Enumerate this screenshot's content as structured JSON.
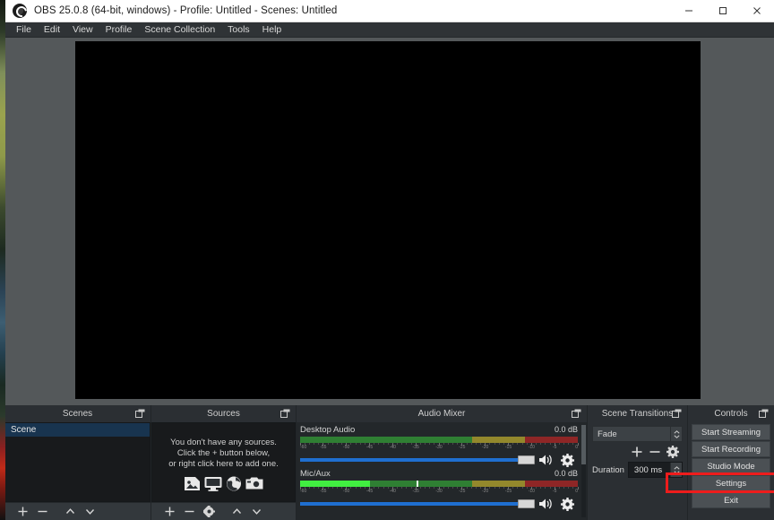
{
  "window": {
    "title": "OBS 25.0.8 (64-bit, windows) - Profile: Untitled - Scenes: Untitled",
    "app_icon": "obs-logo-icon",
    "buttons": {
      "minimize": "minimize-icon",
      "maximize": "maximize-icon",
      "close": "close-icon"
    }
  },
  "menubar": {
    "items": [
      {
        "label": "File"
      },
      {
        "label": "Edit"
      },
      {
        "label": "View"
      },
      {
        "label": "Profile"
      },
      {
        "label": "Scene Collection"
      },
      {
        "label": "Tools"
      },
      {
        "label": "Help"
      }
    ]
  },
  "preview": {
    "background_color": "#000000"
  },
  "docks": {
    "scenes": {
      "title": "Scenes",
      "float_icon": "undock-icon",
      "items": [
        {
          "label": "Scene",
          "selected": true
        }
      ],
      "toolbar": [
        {
          "name": "add-scene-button",
          "icon": "plus-icon"
        },
        {
          "name": "remove-scene-button",
          "icon": "minus-icon"
        },
        {
          "name": "move-scene-up-button",
          "icon": "chevron-up-icon"
        },
        {
          "name": "move-scene-down-button",
          "icon": "chevron-down-icon"
        }
      ]
    },
    "sources": {
      "title": "Sources",
      "float_icon": "undock-icon",
      "empty_message": [
        "You don't have any sources.",
        "Click the + button below,",
        "or right click here to add one."
      ],
      "empty_icons": [
        "image-icon",
        "display-capture-icon",
        "browser-globe-icon",
        "camera-icon"
      ],
      "toolbar": [
        {
          "name": "add-source-button",
          "icon": "plus-icon"
        },
        {
          "name": "remove-source-button",
          "icon": "minus-icon"
        },
        {
          "name": "source-properties-button",
          "icon": "gear-icon"
        },
        {
          "name": "move-source-up-button",
          "icon": "chevron-up-icon"
        },
        {
          "name": "move-source-down-button",
          "icon": "chevron-down-icon"
        }
      ]
    },
    "audio_mixer": {
      "title": "Audio Mixer",
      "float_icon": "undock-icon",
      "ruler_ticks": [
        "-60",
        "-55",
        "-50",
        "-45",
        "-40",
        "-35",
        "-30",
        "-25",
        "-20",
        "-15",
        "-10",
        "-5",
        "0"
      ],
      "tracks": [
        {
          "name": "Desktop Audio",
          "db": "0.0 dB",
          "level_percent": 0,
          "peak_percent": 0,
          "volume_percent": 100,
          "mute_icon": "speaker-icon",
          "settings_icon": "gear-icon"
        },
        {
          "name": "Mic/Aux",
          "db": "0.0 dB",
          "level_percent": 25,
          "peak_percent": 42,
          "volume_percent": 100,
          "mute_icon": "speaker-icon",
          "settings_icon": "gear-icon"
        }
      ]
    },
    "scene_transitions": {
      "title": "Scene Transitions",
      "float_icon": "undock-icon",
      "transition": "Fade",
      "buttons": [
        {
          "name": "add-transition-button",
          "icon": "plus-icon"
        },
        {
          "name": "remove-transition-button",
          "icon": "minus-icon"
        },
        {
          "name": "transition-properties-button",
          "icon": "gear-icon"
        }
      ],
      "duration_label": "Duration",
      "duration_value": "300 ms"
    },
    "controls": {
      "title": "Controls",
      "float_icon": "undock-icon",
      "buttons": [
        {
          "label": "Start Streaming",
          "name": "start-streaming-button",
          "highlighted": false
        },
        {
          "label": "Start Recording",
          "name": "start-recording-button",
          "highlighted": false
        },
        {
          "label": "Studio Mode",
          "name": "studio-mode-button",
          "highlighted": false
        },
        {
          "label": "Settings",
          "name": "settings-button",
          "highlighted": true
        },
        {
          "label": "Exit",
          "name": "exit-button",
          "highlighted": false
        }
      ]
    }
  },
  "annotation": {
    "highlight_color": "#ee1c1c",
    "target": "Settings"
  }
}
